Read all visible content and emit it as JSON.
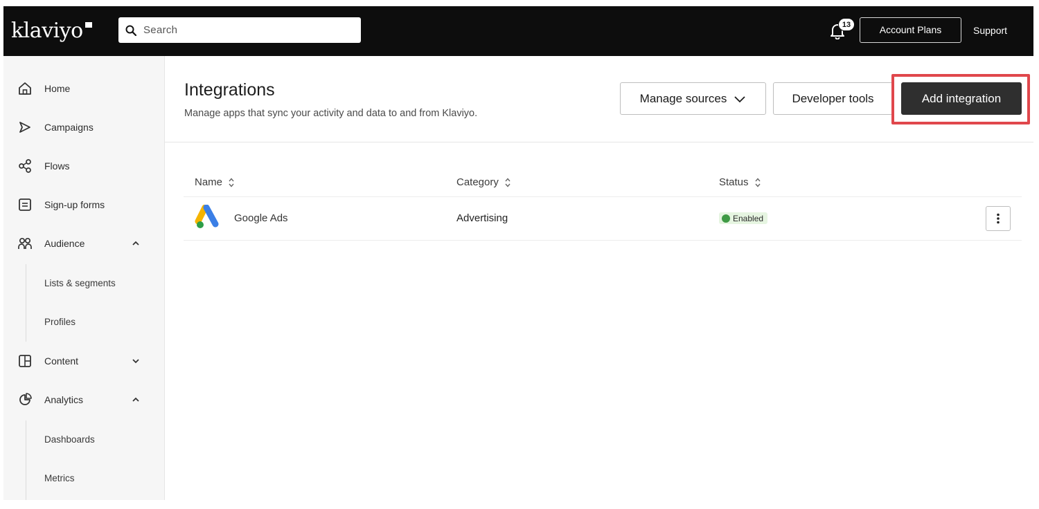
{
  "topbar": {
    "logo_text": "klaviyo",
    "search_placeholder": "Search",
    "notification_count": "13",
    "account_plans_label": "Account Plans",
    "support_label": "Support"
  },
  "sidebar": {
    "items": [
      {
        "label": "Home",
        "icon": "home-icon"
      },
      {
        "label": "Campaigns",
        "icon": "campaigns-icon"
      },
      {
        "label": "Flows",
        "icon": "flows-icon"
      },
      {
        "label": "Sign-up forms",
        "icon": "form-icon"
      },
      {
        "label": "Audience",
        "icon": "audience-icon",
        "expanded": true
      },
      {
        "label": "Content",
        "icon": "content-icon",
        "expanded": false
      },
      {
        "label": "Analytics",
        "icon": "analytics-icon",
        "expanded": true
      }
    ],
    "audience_sub": [
      "Lists & segments",
      "Profiles"
    ],
    "analytics_sub": [
      "Dashboards",
      "Metrics"
    ]
  },
  "page": {
    "title": "Integrations",
    "subtitle": "Manage apps that sync your activity and data to and from Klaviyo.",
    "manage_sources_label": "Manage sources",
    "developer_tools_label": "Developer tools",
    "add_integration_label": "Add integration"
  },
  "table": {
    "columns": [
      "Name",
      "Category",
      "Status"
    ],
    "rows": [
      {
        "name": "Google Ads",
        "category": "Advertising",
        "status": "Enabled"
      }
    ]
  },
  "colors": {
    "topbar": "#0d0d0d",
    "highlight": "#e0474c",
    "status_enabled": "#3f9a45",
    "primary_button": "#2f2f2f"
  }
}
